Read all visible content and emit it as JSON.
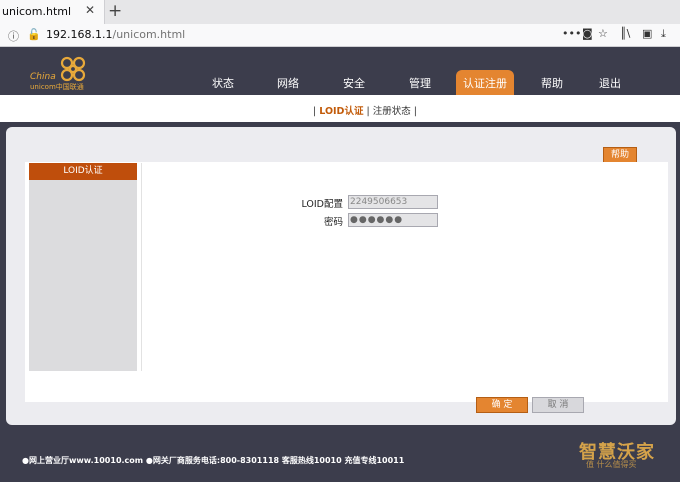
{
  "browser": {
    "tab_title": "unicom.html",
    "tab_close": "✕",
    "new_tab": "+",
    "url_host": "192.168.1.1",
    "url_path": "/unicom.html",
    "toolbar_more": "•••"
  },
  "logo": {
    "china": "China",
    "unicom": "unicom中国联通"
  },
  "nav": {
    "items": [
      "状态",
      "网络",
      "安全",
      "管理",
      "认证注册",
      "帮助",
      "退出"
    ],
    "active": "认证注册"
  },
  "subnav": {
    "prefix": "| ",
    "active": "LOID认证",
    "rest": " | 注册状态 |"
  },
  "help_label": "帮助",
  "sidebar": {
    "active_item": "LOID认证"
  },
  "form": {
    "loid_label": "LOID配置",
    "loid_value": "2249506653",
    "password_label": "密码",
    "password_value": "●●●●●●"
  },
  "buttons": {
    "confirm": "确 定",
    "cancel": "取 消"
  },
  "footer": {
    "text": "●网上营业厅www.10010.com ●网关厂商服务电话:800-8301118 客服热线10010 充值专线10011"
  },
  "watermark": {
    "text": "智慧沃家",
    "sub": "值 什么值得买"
  },
  "colors": {
    "accent": "#e48530",
    "sidebar_active": "#bf4e0c",
    "header_bg": "#3c3d4c"
  }
}
